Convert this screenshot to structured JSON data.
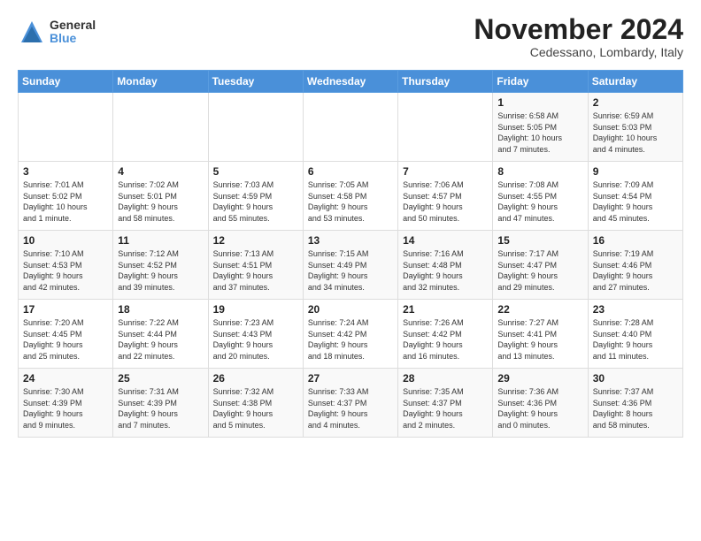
{
  "logo": {
    "general": "General",
    "blue": "Blue"
  },
  "title": "November 2024",
  "location": "Cedessano, Lombardy, Italy",
  "headers": [
    "Sunday",
    "Monday",
    "Tuesday",
    "Wednesday",
    "Thursday",
    "Friday",
    "Saturday"
  ],
  "weeks": [
    [
      {
        "day": "",
        "info": ""
      },
      {
        "day": "",
        "info": ""
      },
      {
        "day": "",
        "info": ""
      },
      {
        "day": "",
        "info": ""
      },
      {
        "day": "",
        "info": ""
      },
      {
        "day": "1",
        "info": "Sunrise: 6:58 AM\nSunset: 5:05 PM\nDaylight: 10 hours\nand 7 minutes."
      },
      {
        "day": "2",
        "info": "Sunrise: 6:59 AM\nSunset: 5:03 PM\nDaylight: 10 hours\nand 4 minutes."
      }
    ],
    [
      {
        "day": "3",
        "info": "Sunrise: 7:01 AM\nSunset: 5:02 PM\nDaylight: 10 hours\nand 1 minute."
      },
      {
        "day": "4",
        "info": "Sunrise: 7:02 AM\nSunset: 5:01 PM\nDaylight: 9 hours\nand 58 minutes."
      },
      {
        "day": "5",
        "info": "Sunrise: 7:03 AM\nSunset: 4:59 PM\nDaylight: 9 hours\nand 55 minutes."
      },
      {
        "day": "6",
        "info": "Sunrise: 7:05 AM\nSunset: 4:58 PM\nDaylight: 9 hours\nand 53 minutes."
      },
      {
        "day": "7",
        "info": "Sunrise: 7:06 AM\nSunset: 4:57 PM\nDaylight: 9 hours\nand 50 minutes."
      },
      {
        "day": "8",
        "info": "Sunrise: 7:08 AM\nSunset: 4:55 PM\nDaylight: 9 hours\nand 47 minutes."
      },
      {
        "day": "9",
        "info": "Sunrise: 7:09 AM\nSunset: 4:54 PM\nDaylight: 9 hours\nand 45 minutes."
      }
    ],
    [
      {
        "day": "10",
        "info": "Sunrise: 7:10 AM\nSunset: 4:53 PM\nDaylight: 9 hours\nand 42 minutes."
      },
      {
        "day": "11",
        "info": "Sunrise: 7:12 AM\nSunset: 4:52 PM\nDaylight: 9 hours\nand 39 minutes."
      },
      {
        "day": "12",
        "info": "Sunrise: 7:13 AM\nSunset: 4:51 PM\nDaylight: 9 hours\nand 37 minutes."
      },
      {
        "day": "13",
        "info": "Sunrise: 7:15 AM\nSunset: 4:49 PM\nDaylight: 9 hours\nand 34 minutes."
      },
      {
        "day": "14",
        "info": "Sunrise: 7:16 AM\nSunset: 4:48 PM\nDaylight: 9 hours\nand 32 minutes."
      },
      {
        "day": "15",
        "info": "Sunrise: 7:17 AM\nSunset: 4:47 PM\nDaylight: 9 hours\nand 29 minutes."
      },
      {
        "day": "16",
        "info": "Sunrise: 7:19 AM\nSunset: 4:46 PM\nDaylight: 9 hours\nand 27 minutes."
      }
    ],
    [
      {
        "day": "17",
        "info": "Sunrise: 7:20 AM\nSunset: 4:45 PM\nDaylight: 9 hours\nand 25 minutes."
      },
      {
        "day": "18",
        "info": "Sunrise: 7:22 AM\nSunset: 4:44 PM\nDaylight: 9 hours\nand 22 minutes."
      },
      {
        "day": "19",
        "info": "Sunrise: 7:23 AM\nSunset: 4:43 PM\nDaylight: 9 hours\nand 20 minutes."
      },
      {
        "day": "20",
        "info": "Sunrise: 7:24 AM\nSunset: 4:42 PM\nDaylight: 9 hours\nand 18 minutes."
      },
      {
        "day": "21",
        "info": "Sunrise: 7:26 AM\nSunset: 4:42 PM\nDaylight: 9 hours\nand 16 minutes."
      },
      {
        "day": "22",
        "info": "Sunrise: 7:27 AM\nSunset: 4:41 PM\nDaylight: 9 hours\nand 13 minutes."
      },
      {
        "day": "23",
        "info": "Sunrise: 7:28 AM\nSunset: 4:40 PM\nDaylight: 9 hours\nand 11 minutes."
      }
    ],
    [
      {
        "day": "24",
        "info": "Sunrise: 7:30 AM\nSunset: 4:39 PM\nDaylight: 9 hours\nand 9 minutes."
      },
      {
        "day": "25",
        "info": "Sunrise: 7:31 AM\nSunset: 4:39 PM\nDaylight: 9 hours\nand 7 minutes."
      },
      {
        "day": "26",
        "info": "Sunrise: 7:32 AM\nSunset: 4:38 PM\nDaylight: 9 hours\nand 5 minutes."
      },
      {
        "day": "27",
        "info": "Sunrise: 7:33 AM\nSunset: 4:37 PM\nDaylight: 9 hours\nand 4 minutes."
      },
      {
        "day": "28",
        "info": "Sunrise: 7:35 AM\nSunset: 4:37 PM\nDaylight: 9 hours\nand 2 minutes."
      },
      {
        "day": "29",
        "info": "Sunrise: 7:36 AM\nSunset: 4:36 PM\nDaylight: 9 hours\nand 0 minutes."
      },
      {
        "day": "30",
        "info": "Sunrise: 7:37 AM\nSunset: 4:36 PM\nDaylight: 8 hours\nand 58 minutes."
      }
    ]
  ]
}
